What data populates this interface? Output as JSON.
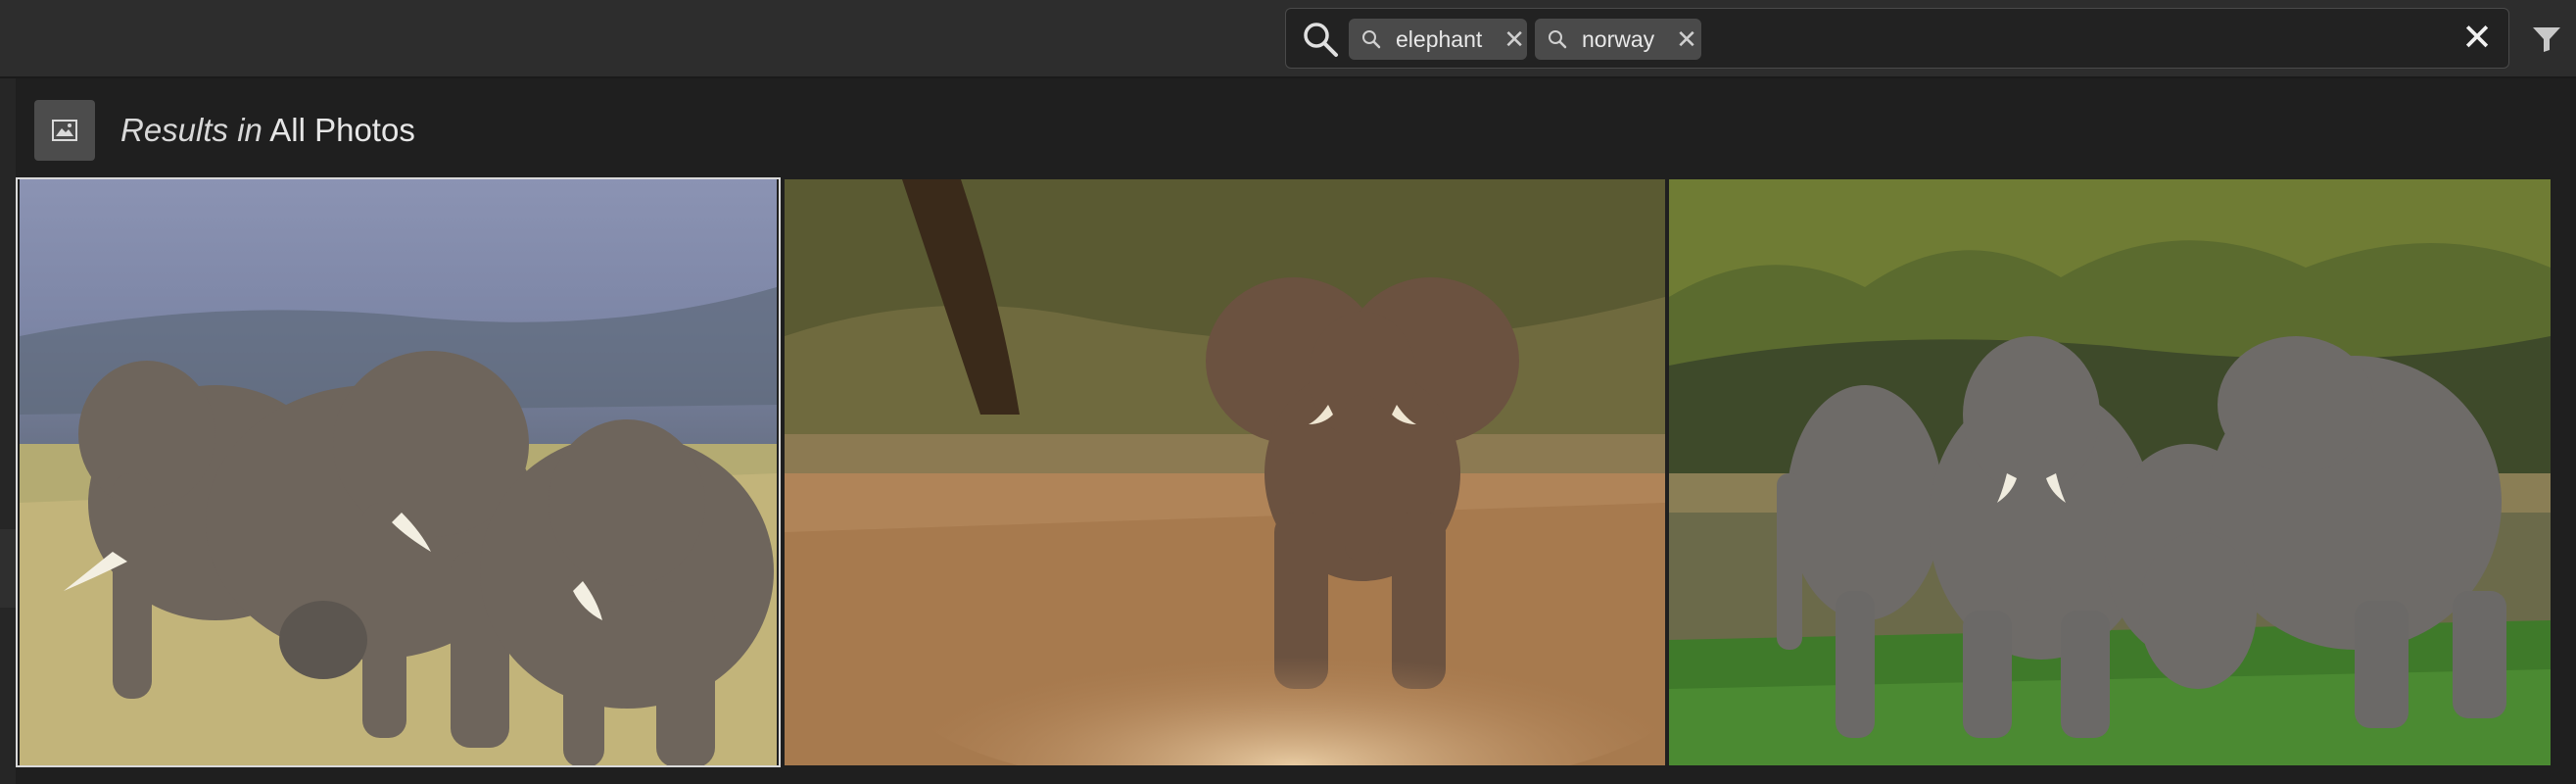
{
  "search": {
    "chips": [
      {
        "label": "elephant",
        "remove_icon": "close-icon"
      },
      {
        "label": "norway",
        "remove_icon": "close-icon"
      }
    ],
    "clear_label": "✕"
  },
  "header": {
    "results_prefix": "Results in",
    "results_scope": "All Photos"
  },
  "icons": {
    "search": "search-icon",
    "filter": "filter-icon",
    "photos": "photos-icon"
  },
  "photos": [
    {
      "selected": true
    },
    {
      "selected": false
    },
    {
      "selected": false
    }
  ]
}
